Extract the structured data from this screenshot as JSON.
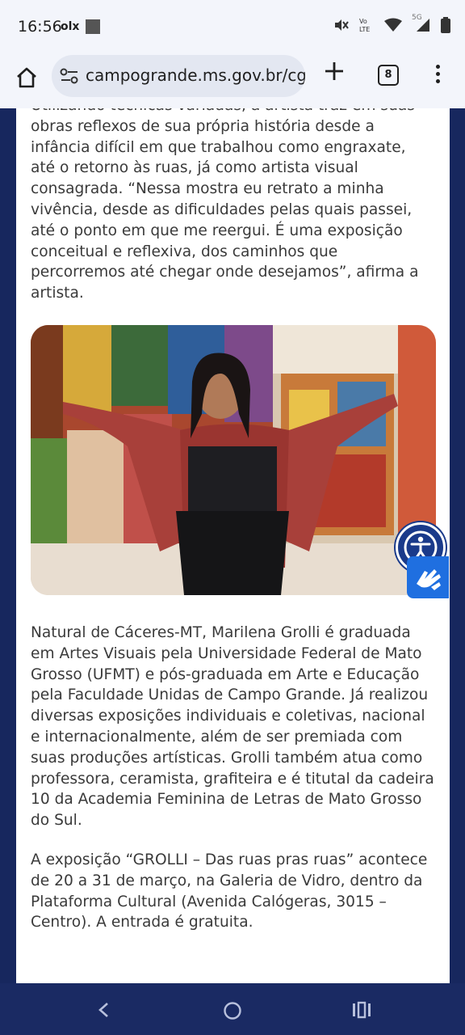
{
  "status_bar": {
    "time": "16:56",
    "carrier_icon": "olx",
    "icons": [
      "mute-icon",
      "volte-icon",
      "wifi-icon",
      "5g-signal-icon",
      "battery-icon"
    ],
    "network_label": "5G"
  },
  "browser": {
    "url": "campogrande.ms.gov.br/cg",
    "tab_count": "8"
  },
  "article": {
    "paragraph_1": "Utilizando técnicas variadas, a artista traz em suas obras reflexos de sua própria história desde a infância difícil em que trabalhou como engraxate, até o retorno às ruas, já como artista visual consagrada. “Nessa mostra eu retrato a minha vivência, desde as dificuldades pelas quais passei, até o ponto em que me reergui. É uma exposição conceitual e reflexiva, dos caminhos que percorremos até chegar onde desejamos”, afirma a artista.",
    "paragraph_2": "Natural de Cáceres-MT, Marilena Grolli é graduada em Artes Visuais pela Universidade Federal de Mato Grosso (UFMT) e pós-graduada em Arte e Educação pela Faculdade Unidas de Campo Grande. Já realizou diversas exposições individuais e coletivas, nacional e internacionalmente, além de ser premiada com suas produções artísticas. Grolli também atua como professora, ceramista, grafiteira e é titutal da cadeira 10 da Academia Feminina de Letras de Mato Grosso do Sul.",
    "paragraph_3": "A exposição “GROLLI – Das ruas pras ruas” acontece de  20 a 31 de março, na Galeria de Vidro, dentro da Plataforma Cultural (Avenida Calógeras, 3015 – Centro). A entrada é gratuita."
  },
  "colors": {
    "page_background": "#17275e",
    "text": "#3a3a3a",
    "accessibility_button": "#1a3a8a",
    "vlibras_button": "#1f6fe0"
  }
}
